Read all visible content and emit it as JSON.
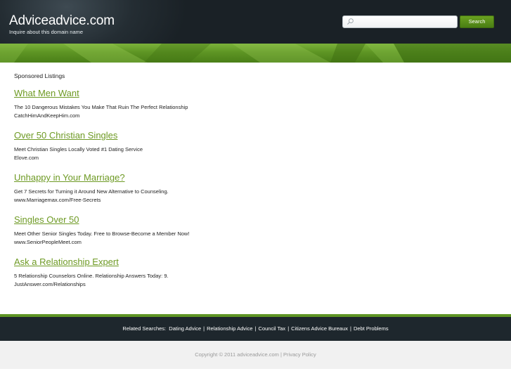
{
  "header": {
    "site_title": "Adviceadvice.com",
    "tagline": "Inquire about this domain name",
    "search": {
      "value": "",
      "placeholder": "",
      "button_label": "Search"
    }
  },
  "main": {
    "sponsored_heading": "Sponsored Listings",
    "listings": [
      {
        "title": "What Men Want",
        "description": "The 10 Dangerous Mistakes You Make That Ruin The Perfect Relationship",
        "url": "CatchHimAndKeepHim.com"
      },
      {
        "title": "Over 50 Christian Singles",
        "description": "Meet Christian Singles Locally Voted #1 Dating Service",
        "url": "Elove.com"
      },
      {
        "title": "Unhappy in Your Marriage?",
        "description": "Get 7 Secrets for Turning it Around New Alternative to Counseling.",
        "url": "www.Marriagemax.com/Free-Secrets"
      },
      {
        "title": "Singles Over 50",
        "description": "Meet Other Senior Singles Today. Free to Browse-Become a Member Now!",
        "url": "www.SeniorPeopleMeet.com"
      },
      {
        "title": "Ask a Relationship Expert",
        "description": "5 Relationship Counselors Online. Relationship Answers Today: 9.",
        "url": "JustAnswer.com/Relationships"
      }
    ]
  },
  "footer": {
    "related_label": "Related Searches:",
    "related_links": [
      "Dating Advice",
      "Relationship Advice",
      "Council Tax",
      "Citizens Advice Bureaux",
      "Debt Problems"
    ],
    "separator": "|",
    "copyright": "Copyright © 2011 adviceadvice.com",
    "privacy_label": "Privacy Policy"
  },
  "colors": {
    "header_bg": "#1a2126",
    "accent_green": "#5e9524",
    "link_green": "#6e9a24",
    "footer_dark": "#1e272d",
    "footer_light": "#f1f1f1"
  }
}
